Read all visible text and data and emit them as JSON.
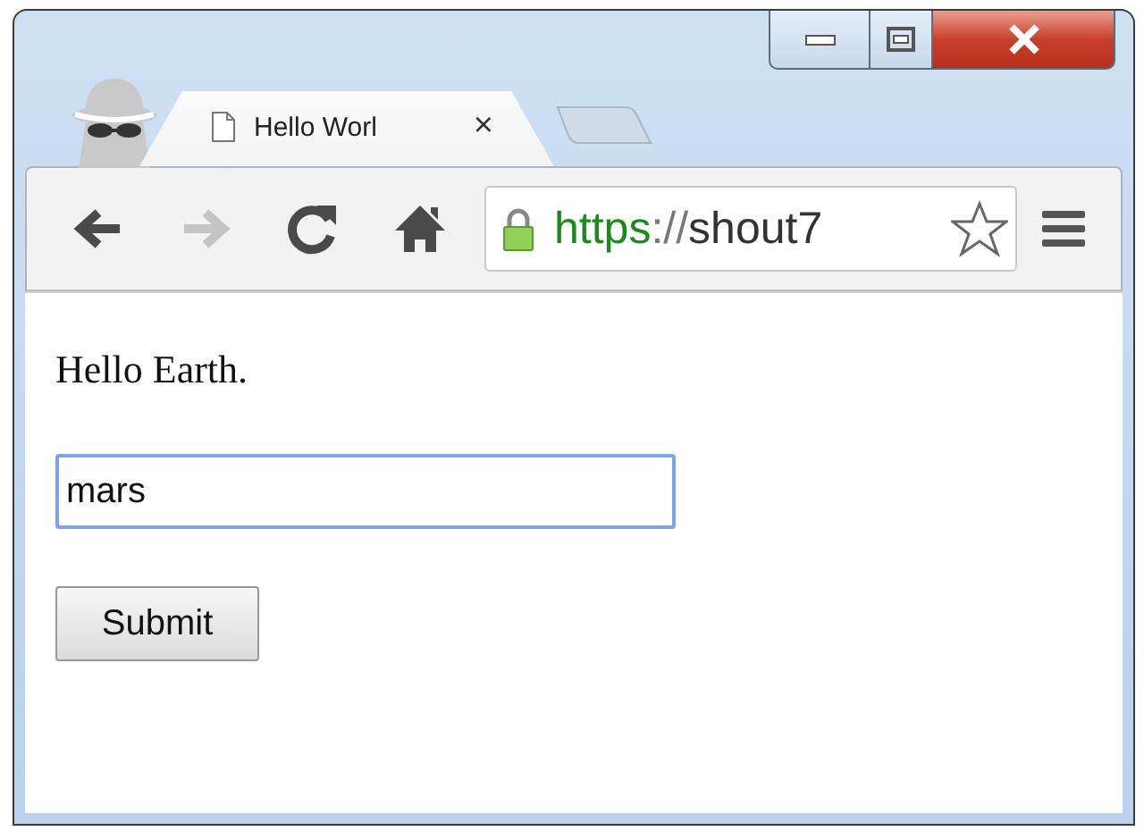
{
  "window": {
    "controls": [
      {
        "kind": "minimize"
      },
      {
        "kind": "maximize"
      },
      {
        "kind": "close"
      }
    ]
  },
  "tabs": [
    {
      "title": "Hello Worl",
      "close_glyph": "×",
      "selected": true
    }
  ],
  "toolbar": {
    "nav_buttons": [
      {
        "kind": "back",
        "disabled": false
      },
      {
        "kind": "forward",
        "disabled": true
      },
      {
        "kind": "reload",
        "disabled": false
      },
      {
        "kind": "home",
        "disabled": false
      }
    ],
    "address": {
      "secure": true,
      "scheme": "https",
      "separator": "://",
      "host": "shout7"
    }
  },
  "page": {
    "greeting": "Hello Earth.",
    "input": {
      "value": "mars",
      "focused": true
    },
    "submit_button": "Submit"
  }
}
